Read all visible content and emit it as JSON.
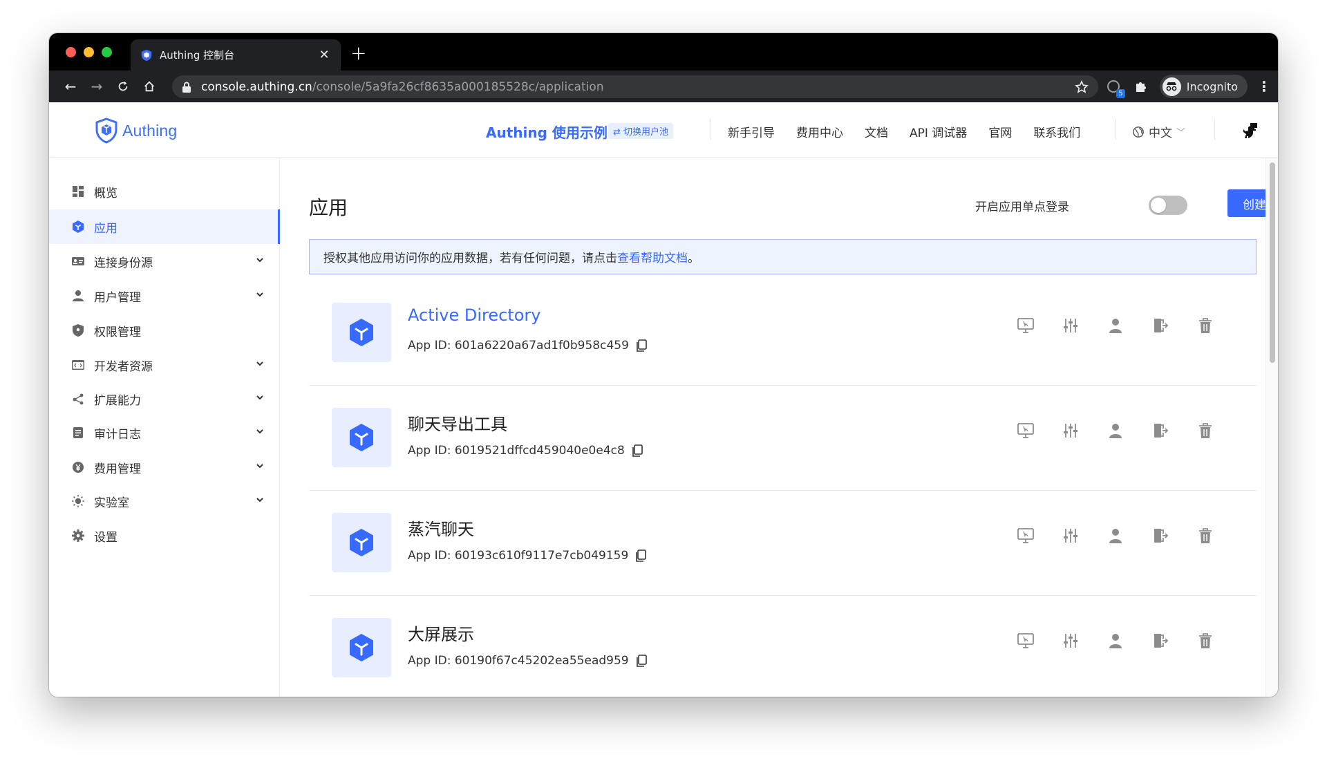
{
  "browser": {
    "tab_title": "Authing 控制台",
    "url_host": "console.authing.cn",
    "url_path": "/console/5a9fa26cf8635a000185528c/application",
    "ext_badge": "5",
    "profile_label": "Incognito"
  },
  "header": {
    "logo_text": "Authing",
    "pool_name": "Authing 使用示例",
    "switch_pool": "⇄ 切换用户池",
    "nav": [
      "新手引导",
      "费用中心",
      "文档",
      "API 调试器",
      "官网",
      "联系我们"
    ],
    "language": "中文"
  },
  "sidebar": {
    "items": [
      {
        "label": "概览",
        "icon": "dashboard-icon",
        "expandable": false,
        "active": false
      },
      {
        "label": "应用",
        "icon": "cube-icon",
        "expandable": false,
        "active": true
      },
      {
        "label": "连接身份源",
        "icon": "id-card-icon",
        "expandable": true,
        "active": false
      },
      {
        "label": "用户管理",
        "icon": "user-icon",
        "expandable": true,
        "active": false
      },
      {
        "label": "权限管理",
        "icon": "shield-icon",
        "expandable": false,
        "active": false
      },
      {
        "label": "开发者资源",
        "icon": "code-icon",
        "expandable": true,
        "active": false
      },
      {
        "label": "扩展能力",
        "icon": "share-nodes-icon",
        "expandable": true,
        "active": false
      },
      {
        "label": "审计日志",
        "icon": "document-icon",
        "expandable": true,
        "active": false
      },
      {
        "label": "费用管理",
        "icon": "yen-icon",
        "expandable": true,
        "active": false
      },
      {
        "label": "实验室",
        "icon": "bulb-icon",
        "expandable": true,
        "active": false
      },
      {
        "label": "设置",
        "icon": "gear-icon",
        "expandable": false,
        "active": false
      }
    ]
  },
  "main": {
    "title": "应用",
    "sso_label": "开启应用单点登录",
    "sso_enabled": false,
    "create_button": "创建应用",
    "info_text": "授权其他应用访问你的应用数据，若有任何问题，请点击",
    "info_link": "查看帮助文档",
    "info_suffix": "。",
    "apps": [
      {
        "name": "Active Directory",
        "id": "App ID: 601a6220a67ad1f0b958c459",
        "link": true
      },
      {
        "name": "聊天导出工具",
        "id": "App ID: 6019521dffcd459040e0e4c8",
        "link": false
      },
      {
        "name": "蒸汽聊天",
        "id": "App ID: 60193c610f9117e7cb049159",
        "link": false
      },
      {
        "name": "大屏展示",
        "id": "App ID: 60190f67c45202ea55ead959",
        "link": false
      }
    ],
    "row_action_icons": [
      "monitor-icon",
      "sliders-icon",
      "user-icon",
      "logout-icon",
      "trash-icon"
    ]
  },
  "colors": {
    "brand": "#396aff",
    "active_bg": "#eef3ff",
    "info_bg": "#eef4ff",
    "toggle_off": "#bfbfbf"
  }
}
